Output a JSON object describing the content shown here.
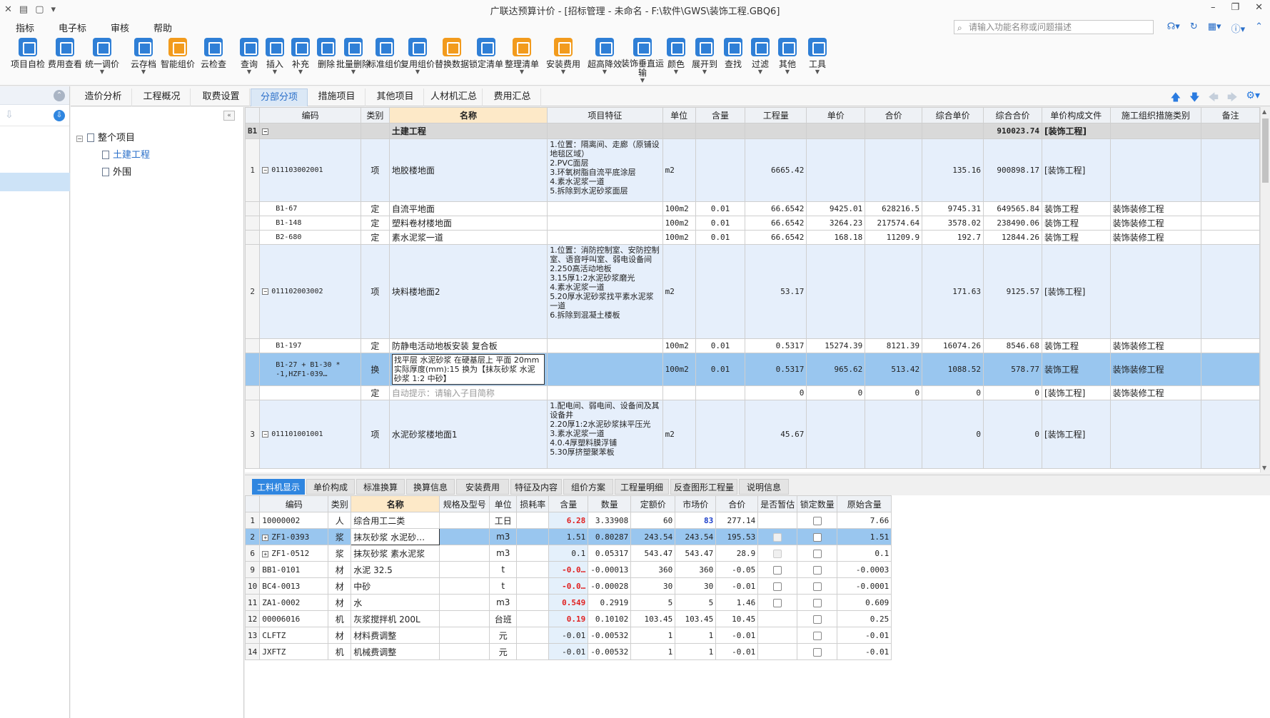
{
  "titlebar": {
    "title": "广联达预算计价 - [招标管理 - 未命名 - F:\\软件\\GWS\\装饰工程.GBQ6]",
    "qa_icons": [
      "close-x",
      "save",
      "file",
      "dropdown"
    ],
    "win_minimize": "–",
    "win_restore": "❐",
    "win_close": "✕"
  },
  "menubar": {
    "items": [
      "指标",
      "电子标",
      "审核",
      "帮助"
    ],
    "search_placeholder": "请输入功能名称或问题描述"
  },
  "ribbon": {
    "buttons": [
      {
        "label": "项目自检",
        "icon": "check-icon",
        "color": "blue",
        "dropdown": false
      },
      {
        "label": "费用查看",
        "icon": "view-fee-icon",
        "color": "blue",
        "dropdown": false
      },
      {
        "label": "统一调价",
        "icon": "adjust-price-icon",
        "color": "blue",
        "dropdown": true
      },
      {
        "label": "云存档",
        "icon": "cloud-save-icon",
        "color": "blue",
        "dropdown": true
      },
      {
        "label": "智能组价",
        "icon": "smart-price-icon",
        "color": "orange",
        "dropdown": false
      },
      {
        "label": "云检查",
        "icon": "cloud-check-icon",
        "color": "blue",
        "dropdown": false
      },
      {
        "label": "查询",
        "icon": "query-icon",
        "color": "blue",
        "dropdown": true
      },
      {
        "label": "插入",
        "icon": "insert-icon",
        "color": "blue",
        "dropdown": true
      },
      {
        "label": "补充",
        "icon": "supplement-icon",
        "color": "blue",
        "dropdown": true
      },
      {
        "label": "删除",
        "icon": "delete-icon",
        "color": "blue",
        "dropdown": false
      },
      {
        "label": "批量删除",
        "icon": "batch-delete-icon",
        "color": "blue",
        "dropdown": true
      },
      {
        "label": "标准组价",
        "icon": "standard-price-icon",
        "color": "blue",
        "dropdown": false
      },
      {
        "label": "复用组价",
        "icon": "reuse-price-icon",
        "color": "blue",
        "dropdown": true
      },
      {
        "label": "替换数据",
        "icon": "replace-data-icon",
        "color": "orange",
        "dropdown": false
      },
      {
        "label": "锁定清单",
        "icon": "lock-icon",
        "color": "blue",
        "dropdown": false
      },
      {
        "label": "整理清单",
        "icon": "organize-icon",
        "color": "orange",
        "dropdown": true
      },
      {
        "label": "安装费用",
        "icon": "install-fee-icon",
        "color": "orange",
        "dropdown": true
      },
      {
        "label": "超高降效",
        "icon": "height-reduce-icon",
        "color": "blue",
        "dropdown": true
      },
      {
        "label": "装饰垂直运输",
        "icon": "vertical-transport-icon",
        "color": "blue",
        "dropdown": true
      },
      {
        "label": "颜色",
        "icon": "color-icon",
        "color": "blue",
        "dropdown": true
      },
      {
        "label": "展开到",
        "icon": "expand-icon",
        "color": "blue",
        "dropdown": true
      },
      {
        "label": "查找",
        "icon": "find-icon",
        "color": "blue",
        "dropdown": false
      },
      {
        "label": "过滤",
        "icon": "filter-icon",
        "color": "blue",
        "dropdown": true
      },
      {
        "label": "其他",
        "icon": "other-icon",
        "color": "blue",
        "dropdown": true
      },
      {
        "label": "工具",
        "icon": "tools-icon",
        "color": "blue",
        "dropdown": true
      }
    ]
  },
  "tabs": [
    "造价分析",
    "工程概况",
    "取费设置",
    "分部分项",
    "措施项目",
    "其他项目",
    "人材机汇总",
    "费用汇总"
  ],
  "active_tab": "分部分项",
  "tree": {
    "root": "整个项目",
    "children": [
      "土建工程",
      "外围"
    ]
  },
  "main_grid": {
    "headers": [
      "编码",
      "类别",
      "名称",
      "项目特征",
      "单位",
      "含量",
      "工程量",
      "单价",
      "合价",
      "综合单价",
      "综合合价",
      "单价构成文件",
      "施工组织措施类别",
      "备注"
    ],
    "section": {
      "rowno": "B1",
      "name": "土建工程",
      "total": "910023.74",
      "file": "[装饰工程]"
    },
    "rows": [
      {
        "type": "bill",
        "rowno": "1",
        "code": "011103002001",
        "cat": "项",
        "name": "地胶楼地面",
        "feat": "1.位置：隔离间、走廊（原铺设地毯区域）\n2.PVC面层\n3.环氧树脂自流平底涂层\n4.素水泥浆一道\n5.拆除到水泥砂浆面层",
        "unit": "m2",
        "qty_c": "",
        "qty": "6665.42",
        "price": "",
        "amount": "",
        "uprice": "135.16",
        "utotal": "900898.17",
        "file": "[装饰工程]",
        "measure": ""
      },
      {
        "type": "quota",
        "rowno": "",
        "code": "B1-67",
        "cat": "定",
        "name": "自流平地面",
        "feat": "",
        "unit": "100m2",
        "qty_c": "0.01",
        "qty": "66.6542",
        "price": "9425.01",
        "amount": "628216.5",
        "uprice": "9745.31",
        "utotal": "649565.84",
        "file": "装饰工程",
        "measure": "装饰装修工程"
      },
      {
        "type": "quota",
        "rowno": "",
        "code": "B1-148",
        "cat": "定",
        "name": "塑料卷材楼地面",
        "feat": "",
        "unit": "100m2",
        "qty_c": "0.01",
        "qty": "66.6542",
        "price": "3264.23",
        "amount": "217574.64",
        "uprice": "3578.02",
        "utotal": "238490.06",
        "file": "装饰工程",
        "measure": "装饰装修工程"
      },
      {
        "type": "quota",
        "rowno": "",
        "code": "B2-680",
        "cat": "定",
        "name": "素水泥浆一道",
        "feat": "",
        "unit": "100m2",
        "qty_c": "0.01",
        "qty": "66.6542",
        "price": "168.18",
        "amount": "11209.9",
        "uprice": "192.7",
        "utotal": "12844.26",
        "file": "装饰工程",
        "measure": "装饰装修工程"
      },
      {
        "type": "bill",
        "rowno": "2",
        "code": "011102003002",
        "cat": "项",
        "name": "块料楼地面2",
        "feat": "1.位置：消防控制室、安防控制室、语音呼叫室、弱电设备间\n2.250高活动地板\n3.15厚1:2水泥砂浆磨光\n4.素水泥浆一道\n5.20厚水泥砂浆找平素水泥浆一道\n6.拆除到混凝土楼板",
        "unit": "m2",
        "qty_c": "",
        "qty": "53.17",
        "price": "",
        "amount": "",
        "uprice": "171.63",
        "utotal": "9125.57",
        "file": "[装饰工程]",
        "measure": ""
      },
      {
        "type": "quota",
        "rowno": "",
        "code": "B1-197",
        "cat": "定",
        "name": "防静电活动地板安装 复合板",
        "feat": "",
        "unit": "100m2",
        "qty_c": "0.01",
        "qty": "0.5317",
        "price": "15274.39",
        "amount": "8121.39",
        "uprice": "16074.26",
        "utotal": "8546.68",
        "file": "装饰工程",
        "measure": "装饰装修工程"
      },
      {
        "type": "sel",
        "rowno": "",
        "code": "B1-27 + B1-30 * -1,HZF1-039…",
        "cat": "换",
        "name": "找平层 水泥砂浆 在硬基层上 平面 20mm 实际厚度(mm):15 换为【抹灰砂浆 水泥砂浆 1:2 中砂】",
        "feat": "",
        "unit": "100m2",
        "qty_c": "0.01",
        "qty": "0.5317",
        "price": "965.62",
        "amount": "513.42",
        "uprice": "1088.52",
        "utotal": "578.77",
        "file": "装饰工程",
        "measure": "装饰装修工程"
      },
      {
        "type": "empty",
        "rowno": "",
        "code": "",
        "cat": "定",
        "name": "自动提示：请输入子目简称",
        "feat": "",
        "unit": "",
        "qty_c": "",
        "qty": "0",
        "price": "0",
        "amount": "0",
        "uprice": "0",
        "utotal": "0",
        "file": "[装饰工程]",
        "measure": "装饰装修工程"
      },
      {
        "type": "bill",
        "rowno": "3",
        "code": "011101001001",
        "cat": "项",
        "name": "水泥砂浆楼地面1",
        "feat": "1.配电间、弱电间、设备间及其设备井\n2.20厚1:2水泥砂浆抹平压光\n3.素水泥浆一道\n4.0.4厚塑料膜浮铺\n5.30厚挤塑聚苯板",
        "unit": "m2",
        "qty_c": "",
        "qty": "45.67",
        "price": "",
        "amount": "",
        "uprice": "0",
        "utotal": "0",
        "file": "[装饰工程]",
        "measure": ""
      }
    ]
  },
  "bottom_tabs": [
    "工料机显示",
    "单价构成",
    "标准换算",
    "换算信息",
    "安装费用",
    "特征及内容",
    "组价方案",
    "工程量明细",
    "反查图形工程量",
    "说明信息"
  ],
  "bottom_grid": {
    "headers": [
      "编码",
      "类别",
      "名称",
      "规格及型号",
      "单位",
      "损耗率",
      "含量",
      "数量",
      "定额价",
      "市场价",
      "合价",
      "是否暂估",
      "锁定数量",
      "原始含量"
    ],
    "rows": [
      {
        "rowno": "1",
        "code": "10000002",
        "cat": "人",
        "name": "综合用工二类",
        "spec": "",
        "unit": "工日",
        "loss": "",
        "qty_c": "6.28",
        "qty": "3.33908",
        "qprice": "60",
        "mprice": "83",
        "total": "277.14",
        "est": "",
        "lock": "box",
        "orig": "7.66",
        "expand": false,
        "redqty": true,
        "bluem": true
      },
      {
        "rowno": "2",
        "code": "ZF1-0393",
        "cat": "浆",
        "name": "抹灰砂浆 水泥砂…",
        "spec": "",
        "unit": "m3",
        "loss": "",
        "qty_c": "1.51",
        "qty": "0.80287",
        "qprice": "243.54",
        "mprice": "243.54",
        "total": "195.53",
        "est": "dis",
        "lock": "box",
        "orig": "1.51",
        "expand": true,
        "sel": true
      },
      {
        "rowno": "6",
        "code": "ZF1-0512",
        "cat": "浆",
        "name": "抹灰砂浆 素水泥浆",
        "spec": "",
        "unit": "m3",
        "loss": "",
        "qty_c": "0.1",
        "qty": "0.05317",
        "qprice": "543.47",
        "mprice": "543.47",
        "total": "28.9",
        "est": "dis",
        "lock": "box",
        "orig": "0.1",
        "expand": true
      },
      {
        "rowno": "9",
        "code": "BB1-0101",
        "cat": "材",
        "name": "水泥 32.5",
        "spec": "",
        "unit": "t",
        "loss": "",
        "qty_c": "-0.0…",
        "qty": "-0.00013",
        "qprice": "360",
        "mprice": "360",
        "total": "-0.05",
        "est": "box",
        "lock": "box",
        "orig": "-0.0003",
        "redqty": true
      },
      {
        "rowno": "10",
        "code": "BC4-0013",
        "cat": "材",
        "name": "中砂",
        "spec": "",
        "unit": "t",
        "loss": "",
        "qty_c": "-0.0…",
        "qty": "-0.00028",
        "qprice": "30",
        "mprice": "30",
        "total": "-0.01",
        "est": "box",
        "lock": "box",
        "orig": "-0.0001",
        "redqty": true
      },
      {
        "rowno": "11",
        "code": "ZA1-0002",
        "cat": "材",
        "name": "水",
        "spec": "",
        "unit": "m3",
        "loss": "",
        "qty_c": "0.549",
        "qty": "0.2919",
        "qprice": "5",
        "mprice": "5",
        "total": "1.46",
        "est": "box",
        "lock": "box",
        "orig": "0.609",
        "redqty": true
      },
      {
        "rowno": "12",
        "code": "00006016",
        "cat": "机",
        "name": "灰浆搅拌机 200L",
        "spec": "",
        "unit": "台班",
        "loss": "",
        "qty_c": "0.19",
        "qty": "0.10102",
        "qprice": "103.45",
        "mprice": "103.45",
        "total": "10.45",
        "est": "",
        "lock": "box",
        "orig": "0.25",
        "redqty": true
      },
      {
        "rowno": "13",
        "code": "CLFTZ",
        "cat": "材",
        "name": "材料费调整",
        "spec": "",
        "unit": "元",
        "loss": "",
        "qty_c": "-0.01",
        "qty": "-0.00532",
        "qprice": "1",
        "mprice": "1",
        "total": "-0.01",
        "est": "",
        "lock": "box",
        "orig": "-0.01"
      },
      {
        "rowno": "14",
        "code": "JXFTZ",
        "cat": "机",
        "name": "机械费调整",
        "spec": "",
        "unit": "元",
        "loss": "",
        "qty_c": "-0.01",
        "qty": "-0.00532",
        "qprice": "1",
        "mprice": "1",
        "total": "-0.01",
        "est": "",
        "lock": "box",
        "orig": "-0.01"
      }
    ]
  }
}
